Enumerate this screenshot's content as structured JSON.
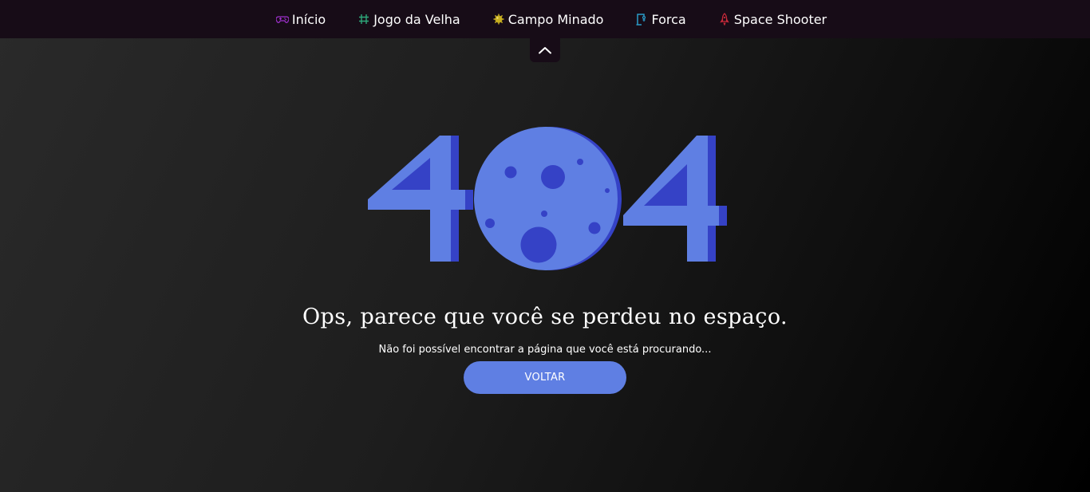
{
  "nav": {
    "items": [
      {
        "label": "Início",
        "icon": "gamepad-icon",
        "icon_color": "#9b30c8"
      },
      {
        "label": "Jogo da Velha",
        "icon": "hash-icon",
        "icon_color": "#2ea77a"
      },
      {
        "label": "Campo Minado",
        "icon": "mine-icon",
        "icon_color": "#c8b020"
      },
      {
        "label": "Forca",
        "icon": "gallows-icon",
        "icon_color": "#2a9bc8"
      },
      {
        "label": "Space Shooter",
        "icon": "rocket-icon",
        "icon_color": "#c82a3a"
      }
    ]
  },
  "error": {
    "code": "404",
    "headline": "Ops, parece que você se perdeu no espaço.",
    "message": "Não foi possível encontrar a página que você está procurando...",
    "button_label": "VOLTAR"
  },
  "colors": {
    "nav_bg": "#170c17",
    "accent": "#5f7fe3",
    "accent_dark": "#3542c6"
  }
}
